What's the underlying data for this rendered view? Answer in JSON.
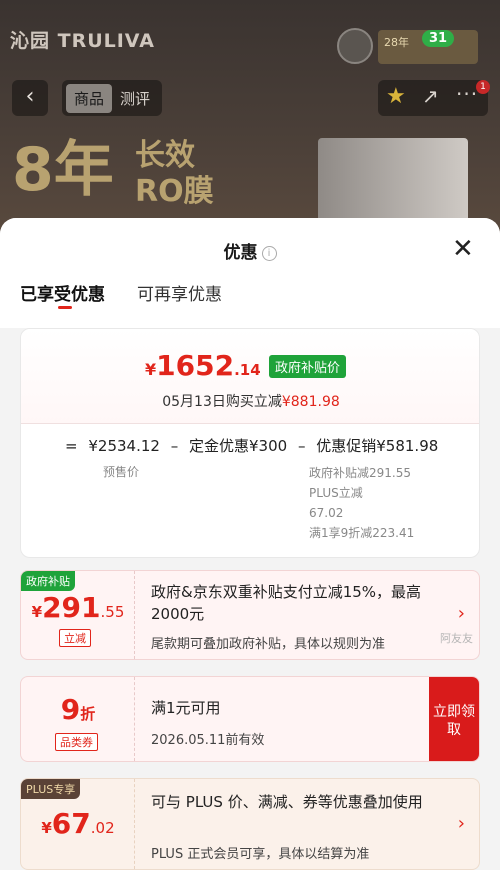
{
  "background": {
    "brand": "沁园 TRULIVA",
    "battery": "31",
    "badge_text": "28年",
    "nav": {
      "back": "‹",
      "tab_goods": "商品",
      "tab_review": "测评",
      "more_count": "1"
    },
    "slogan": {
      "main": "8年",
      "line1": "长效",
      "line2": "RO膜"
    }
  },
  "sheet": {
    "title": "优惠",
    "close": "✕",
    "tabs": [
      "已享受优惠",
      "可再享优惠"
    ],
    "price": {
      "currency": "¥",
      "final_int": "1652",
      "final_dec": ".14",
      "gov_tag": "政府补贴价",
      "buy_prefix": "05月13日购买立减",
      "buy_amount": "¥881.98",
      "formula": [
        "=",
        "¥2534.12",
        "–",
        "定金优惠¥300",
        "–",
        "优惠促销¥581.98"
      ],
      "presale_label": "预售价",
      "promo_details": [
        "政府补贴减291.55",
        "PLUS立减",
        "67.02",
        "满1享9折减223.41"
      ]
    },
    "coupons": [
      {
        "tag": "政府补贴",
        "cur": "¥",
        "int": "291",
        "dec": ".55",
        "chip": "立减",
        "title": "政府&京东双重补贴支付立减15%，最高2000元",
        "sub": "尾款期可叠加政府补贴，具体以规则为准",
        "chevron": "›"
      },
      {
        "int": "9",
        "unit": "折",
        "chip": "品类券",
        "title": "满1元可用",
        "sub": "2026.05.11前有效",
        "claim": "立即领取"
      },
      {
        "tag": "PLUS专享",
        "cur": "¥",
        "int": "67",
        "dec": ".02",
        "title": "可与 PLUS 价、满减、券等优惠叠加使用",
        "sub": "PLUS 正式会员可享，具体以结算为准",
        "chevron": "›"
      }
    ]
  },
  "watermark": "阿友友",
  "colors": {
    "accent": "#e1251b",
    "gov_green": "#1fa33a",
    "claim_red": "#d91b1b"
  }
}
